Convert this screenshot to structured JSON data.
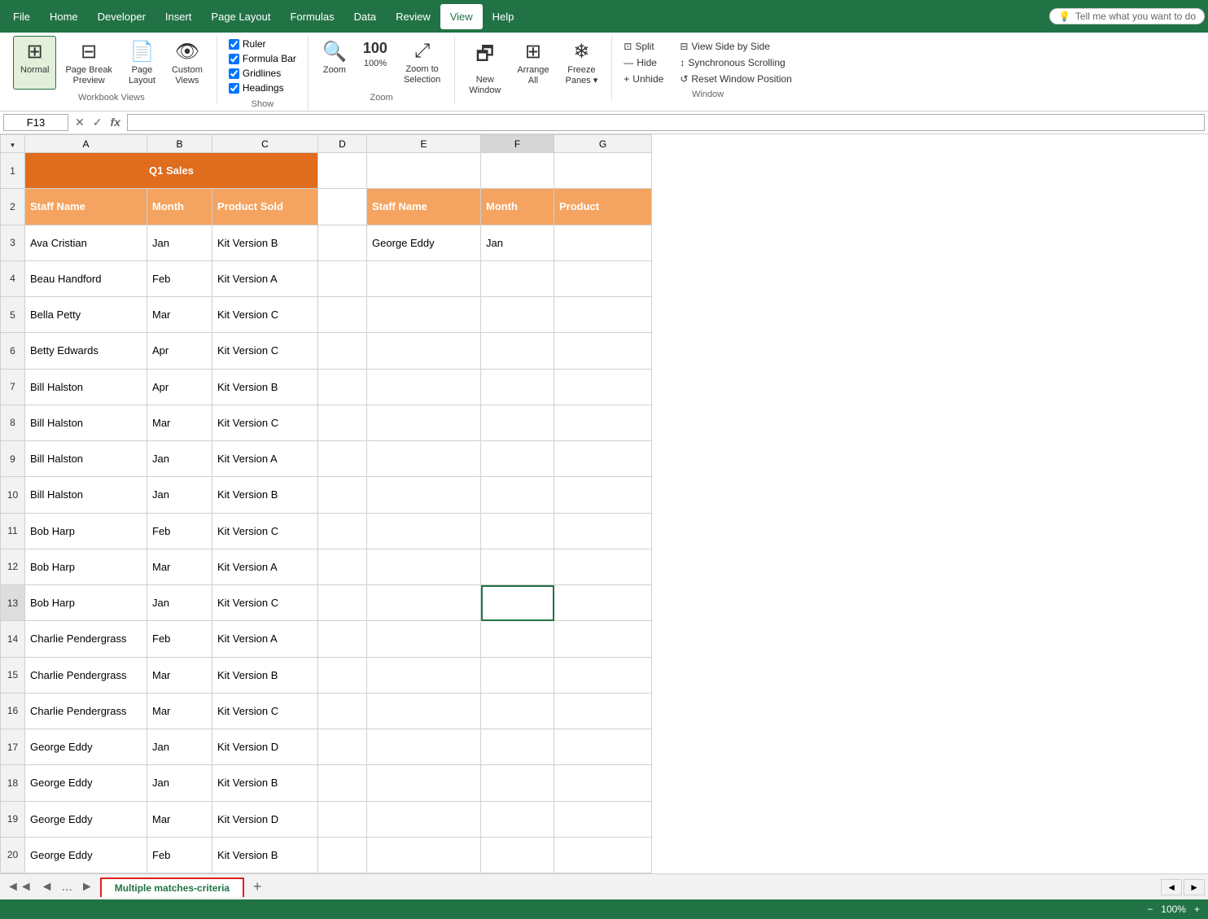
{
  "menuBar": {
    "items": [
      "File",
      "Home",
      "Developer",
      "Insert",
      "Page Layout",
      "Formulas",
      "Data",
      "Review",
      "View",
      "Help"
    ],
    "active": "View",
    "tellMe": "Tell me what you want to do"
  },
  "ribbon": {
    "groups": {
      "workbookViews": {
        "label": "Workbook Views",
        "buttons": [
          {
            "id": "normal",
            "label": "Normal",
            "active": true
          },
          {
            "id": "pageBreak",
            "label": "Page Break\nPreview",
            "active": false
          },
          {
            "id": "pageLayout",
            "label": "Page\nLayout",
            "active": false
          },
          {
            "id": "customViews",
            "label": "Custom\nViews",
            "active": false
          }
        ]
      },
      "show": {
        "label": "Show",
        "checks": [
          {
            "id": "ruler",
            "label": "Ruler",
            "checked": true
          },
          {
            "id": "gridlines",
            "label": "Gridlines",
            "checked": true
          },
          {
            "id": "formulaBar",
            "label": "Formula Bar",
            "checked": true
          },
          {
            "id": "headings",
            "label": "Headings",
            "checked": true
          }
        ]
      },
      "zoom": {
        "label": "Zoom",
        "buttons": [
          {
            "id": "zoom",
            "label": "Zoom"
          },
          {
            "id": "zoom100",
            "label": "100%"
          },
          {
            "id": "zoomToSelection",
            "label": "Zoom to\nSelection"
          }
        ]
      },
      "arrange": {
        "label": "",
        "buttons": [
          {
            "id": "newWindow",
            "label": "New\nWindow"
          },
          {
            "id": "arrangeAll",
            "label": "Arrange\nAll"
          },
          {
            "id": "freezePanes",
            "label": "Freeze\nPanes"
          }
        ]
      },
      "window": {
        "label": "Window",
        "items": [
          {
            "id": "split",
            "label": "Split"
          },
          {
            "id": "hide",
            "label": "Hide"
          },
          {
            "id": "unhide",
            "label": "Unhide"
          },
          {
            "id": "viewSideBySide",
            "label": "View Side by Side"
          },
          {
            "id": "synchronousScrolling",
            "label": "Synchronous Scrolling"
          },
          {
            "id": "resetWindowPosition",
            "label": "Reset Window Position"
          }
        ]
      }
    }
  },
  "formulaBar": {
    "cellRef": "F13",
    "formula": ""
  },
  "spreadsheet": {
    "columns": [
      "A",
      "B",
      "C",
      "D",
      "E",
      "F",
      "G"
    ],
    "rows": [
      {
        "num": 1,
        "cells": [
          {
            "v": "Q1 Sales",
            "cls": "cell-orange-header",
            "span": 3
          },
          {
            "v": "",
            "cls": ""
          },
          {
            "v": "",
            "cls": ""
          },
          {
            "v": "",
            "cls": ""
          },
          {
            "v": "",
            "cls": ""
          }
        ]
      },
      {
        "num": 2,
        "cells": [
          {
            "v": "Staff Name",
            "cls": "cell-orange-bg"
          },
          {
            "v": "Month",
            "cls": "cell-orange-bg"
          },
          {
            "v": "Product Sold",
            "cls": "cell-orange-bg"
          },
          {
            "v": "",
            "cls": ""
          },
          {
            "v": "Staff Name",
            "cls": "cell-orange-bg"
          },
          {
            "v": "Month",
            "cls": "cell-orange-bg"
          },
          {
            "v": "Product",
            "cls": "cell-orange-bg"
          }
        ]
      },
      {
        "num": 3,
        "cells": [
          {
            "v": "Ava Cristian",
            "cls": ""
          },
          {
            "v": "Jan",
            "cls": ""
          },
          {
            "v": "Kit Version B",
            "cls": ""
          },
          {
            "v": "",
            "cls": ""
          },
          {
            "v": "George Eddy",
            "cls": ""
          },
          {
            "v": "Jan",
            "cls": ""
          },
          {
            "v": "",
            "cls": ""
          }
        ]
      },
      {
        "num": 4,
        "cells": [
          {
            "v": "Beau Handford",
            "cls": ""
          },
          {
            "v": "Feb",
            "cls": ""
          },
          {
            "v": "Kit Version A",
            "cls": ""
          },
          {
            "v": "",
            "cls": ""
          },
          {
            "v": "",
            "cls": ""
          },
          {
            "v": "",
            "cls": ""
          },
          {
            "v": "",
            "cls": ""
          }
        ]
      },
      {
        "num": 5,
        "cells": [
          {
            "v": "Bella Petty",
            "cls": ""
          },
          {
            "v": "Mar",
            "cls": ""
          },
          {
            "v": "Kit Version C",
            "cls": ""
          },
          {
            "v": "",
            "cls": ""
          },
          {
            "v": "",
            "cls": ""
          },
          {
            "v": "",
            "cls": ""
          },
          {
            "v": "",
            "cls": ""
          }
        ]
      },
      {
        "num": 6,
        "cells": [
          {
            "v": "Betty Edwards",
            "cls": ""
          },
          {
            "v": "Apr",
            "cls": ""
          },
          {
            "v": "Kit Version C",
            "cls": ""
          },
          {
            "v": "",
            "cls": ""
          },
          {
            "v": "",
            "cls": ""
          },
          {
            "v": "",
            "cls": ""
          },
          {
            "v": "",
            "cls": ""
          }
        ]
      },
      {
        "num": 7,
        "cells": [
          {
            "v": "Bill Halston",
            "cls": ""
          },
          {
            "v": "Apr",
            "cls": ""
          },
          {
            "v": "Kit Version B",
            "cls": ""
          },
          {
            "v": "",
            "cls": ""
          },
          {
            "v": "",
            "cls": ""
          },
          {
            "v": "",
            "cls": ""
          },
          {
            "v": "",
            "cls": ""
          }
        ]
      },
      {
        "num": 8,
        "cells": [
          {
            "v": "Bill Halston",
            "cls": ""
          },
          {
            "v": "Mar",
            "cls": ""
          },
          {
            "v": "Kit Version C",
            "cls": ""
          },
          {
            "v": "",
            "cls": ""
          },
          {
            "v": "",
            "cls": ""
          },
          {
            "v": "",
            "cls": ""
          },
          {
            "v": "",
            "cls": ""
          }
        ]
      },
      {
        "num": 9,
        "cells": [
          {
            "v": "Bill Halston",
            "cls": ""
          },
          {
            "v": "Jan",
            "cls": ""
          },
          {
            "v": "Kit Version A",
            "cls": ""
          },
          {
            "v": "",
            "cls": ""
          },
          {
            "v": "",
            "cls": ""
          },
          {
            "v": "",
            "cls": ""
          },
          {
            "v": "",
            "cls": ""
          }
        ]
      },
      {
        "num": 10,
        "cells": [
          {
            "v": "Bill Halston",
            "cls": ""
          },
          {
            "v": "Jan",
            "cls": ""
          },
          {
            "v": "Kit Version B",
            "cls": ""
          },
          {
            "v": "",
            "cls": ""
          },
          {
            "v": "",
            "cls": ""
          },
          {
            "v": "",
            "cls": ""
          },
          {
            "v": "",
            "cls": ""
          }
        ]
      },
      {
        "num": 11,
        "cells": [
          {
            "v": "Bob Harp",
            "cls": ""
          },
          {
            "v": "Feb",
            "cls": ""
          },
          {
            "v": "Kit Version C",
            "cls": ""
          },
          {
            "v": "",
            "cls": ""
          },
          {
            "v": "",
            "cls": ""
          },
          {
            "v": "",
            "cls": ""
          },
          {
            "v": "",
            "cls": ""
          }
        ]
      },
      {
        "num": 12,
        "cells": [
          {
            "v": "Bob Harp",
            "cls": ""
          },
          {
            "v": "Mar",
            "cls": ""
          },
          {
            "v": "Kit Version A",
            "cls": ""
          },
          {
            "v": "",
            "cls": ""
          },
          {
            "v": "",
            "cls": ""
          },
          {
            "v": "",
            "cls": ""
          },
          {
            "v": "",
            "cls": ""
          }
        ]
      },
      {
        "num": 13,
        "cells": [
          {
            "v": "Bob Harp",
            "cls": ""
          },
          {
            "v": "Jan",
            "cls": ""
          },
          {
            "v": "Kit Version C",
            "cls": ""
          },
          {
            "v": "",
            "cls": ""
          },
          {
            "v": "",
            "cls": ""
          },
          {
            "v": "",
            "cls": "selected-cell"
          },
          {
            "v": "",
            "cls": ""
          }
        ]
      },
      {
        "num": 14,
        "cells": [
          {
            "v": "Charlie Pendergrass",
            "cls": ""
          },
          {
            "v": "Feb",
            "cls": ""
          },
          {
            "v": "Kit Version A",
            "cls": ""
          },
          {
            "v": "",
            "cls": ""
          },
          {
            "v": "",
            "cls": ""
          },
          {
            "v": "",
            "cls": ""
          },
          {
            "v": "",
            "cls": ""
          }
        ]
      },
      {
        "num": 15,
        "cells": [
          {
            "v": "Charlie Pendergrass",
            "cls": ""
          },
          {
            "v": "Mar",
            "cls": ""
          },
          {
            "v": "Kit Version B",
            "cls": ""
          },
          {
            "v": "",
            "cls": ""
          },
          {
            "v": "",
            "cls": ""
          },
          {
            "v": "",
            "cls": ""
          },
          {
            "v": "",
            "cls": ""
          }
        ]
      },
      {
        "num": 16,
        "cells": [
          {
            "v": "Charlie Pendergrass",
            "cls": ""
          },
          {
            "v": "Mar",
            "cls": ""
          },
          {
            "v": "Kit Version C",
            "cls": ""
          },
          {
            "v": "",
            "cls": ""
          },
          {
            "v": "",
            "cls": ""
          },
          {
            "v": "",
            "cls": ""
          },
          {
            "v": "",
            "cls": ""
          }
        ]
      },
      {
        "num": 17,
        "cells": [
          {
            "v": "George Eddy",
            "cls": ""
          },
          {
            "v": "Jan",
            "cls": ""
          },
          {
            "v": "Kit Version D",
            "cls": ""
          },
          {
            "v": "",
            "cls": ""
          },
          {
            "v": "",
            "cls": ""
          },
          {
            "v": "",
            "cls": ""
          },
          {
            "v": "",
            "cls": ""
          }
        ]
      },
      {
        "num": 18,
        "cells": [
          {
            "v": "George Eddy",
            "cls": ""
          },
          {
            "v": "Jan",
            "cls": ""
          },
          {
            "v": "Kit Version B",
            "cls": ""
          },
          {
            "v": "",
            "cls": ""
          },
          {
            "v": "",
            "cls": ""
          },
          {
            "v": "",
            "cls": ""
          },
          {
            "v": "",
            "cls": ""
          }
        ]
      },
      {
        "num": 19,
        "cells": [
          {
            "v": "George Eddy",
            "cls": ""
          },
          {
            "v": "Mar",
            "cls": ""
          },
          {
            "v": "Kit Version D",
            "cls": ""
          },
          {
            "v": "",
            "cls": ""
          },
          {
            "v": "",
            "cls": ""
          },
          {
            "v": "",
            "cls": ""
          },
          {
            "v": "",
            "cls": ""
          }
        ]
      },
      {
        "num": 20,
        "cells": [
          {
            "v": "George Eddy",
            "cls": ""
          },
          {
            "v": "Feb",
            "cls": ""
          },
          {
            "v": "Kit Version B",
            "cls": ""
          },
          {
            "v": "",
            "cls": ""
          },
          {
            "v": "",
            "cls": ""
          },
          {
            "v": "",
            "cls": ""
          },
          {
            "v": "",
            "cls": ""
          }
        ]
      }
    ]
  },
  "sheetTab": {
    "name": "Multiple matches-criteria"
  },
  "icons": {
    "normal": "⊞",
    "pageBreak": "⊟",
    "pageLayout": "📄",
    "customViews": "👁",
    "zoom": "🔍",
    "zoom100": "100",
    "zoomToSelection": "⤢",
    "newWindow": "🗗",
    "arrangeAll": "⊞",
    "freezePanes": "❄",
    "split": "⊡",
    "hide": "—",
    "unhide": "+",
    "viewSideBySide": "⊟",
    "syncScroll": "↕",
    "resetWindow": "↺",
    "search": "💡",
    "checkmark": "✓",
    "cross": "✕",
    "fx": "fx",
    "addSheet": "+",
    "scrollLeft": "◄",
    "scrollRight": "►",
    "cornerArrow": "▼"
  }
}
